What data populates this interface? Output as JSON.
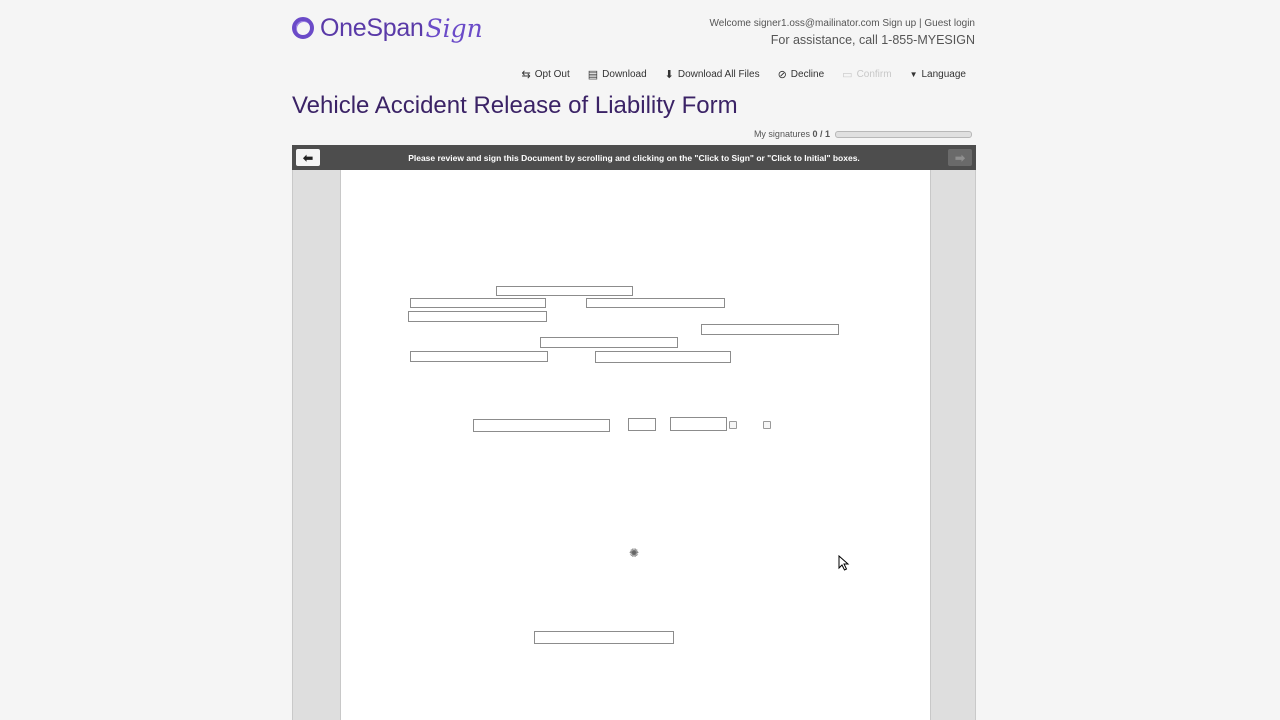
{
  "brand": {
    "name_one": "OneSpan",
    "name_sign": "Sign"
  },
  "header": {
    "welcome_prefix": "Welcome signer1.oss@mailinator.com",
    "signup_label": "Sign up",
    "separator": "|",
    "guest_label": "Guest login",
    "assistance": "For assistance, call 1-855-MYESIGN"
  },
  "toolbar": {
    "opt_out": "Opt Out",
    "download": "Download",
    "download_all": "Download All Files",
    "decline": "Decline",
    "confirm": "Confirm",
    "language": "Language"
  },
  "document": {
    "title": "Vehicle Accident Release of Liability Form",
    "signatures_label": "My signatures",
    "signatures_count": "0 / 1",
    "signatures_done": 0,
    "signatures_total": 1,
    "instructions": "Please review and sign this Document by scrolling and clicking on the \"Click to Sign\" or \"Click to Initial\" boxes."
  },
  "colors": {
    "brand": "#6b4bc8",
    "title": "#3b2366",
    "bar": "#4d4d4d"
  }
}
